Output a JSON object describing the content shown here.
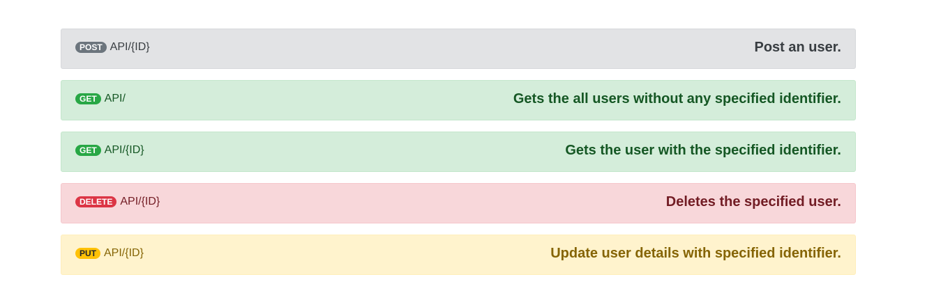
{
  "endpoints": [
    {
      "method": "POST",
      "route": "API/{ID}",
      "description": "Post an user.",
      "variant": "secondary"
    },
    {
      "method": "GET",
      "route": "API/",
      "description": "Gets the all users without any specified identifier.",
      "variant": "success"
    },
    {
      "method": "GET",
      "route": "API/{ID}",
      "description": "Gets the user with the specified identifier.",
      "variant": "success"
    },
    {
      "method": "DELETE",
      "route": "API/{ID}",
      "description": "Deletes the specified user.",
      "variant": "danger"
    },
    {
      "method": "PUT",
      "route": "API/{ID}",
      "description": "Update user details with specified identifier.",
      "variant": "warning"
    }
  ],
  "colors": {
    "secondary": "#6c757d",
    "success": "#28a745",
    "danger": "#dc3545",
    "warning": "#ffc107"
  }
}
